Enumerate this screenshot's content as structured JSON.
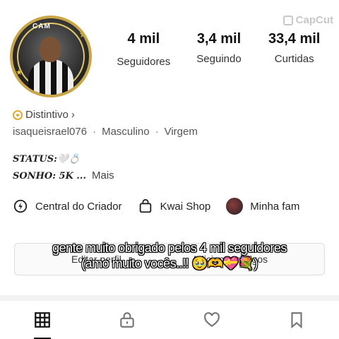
{
  "watermark": "CapCut",
  "avatar": {
    "tag": "CAM"
  },
  "stats": [
    {
      "value": "4 mil",
      "label": "Seguidores"
    },
    {
      "value": "3,4 mil",
      "label": "Seguindo"
    },
    {
      "value": "33,4 mil",
      "label": "Curtidas"
    }
  ],
  "badge": {
    "label": "Distintivo",
    "chevron": "›"
  },
  "meta": {
    "username": "isaqueisrael076",
    "gender": "Masculino",
    "sign": "Virgem",
    "separator": "·"
  },
  "bio": {
    "line1": "STATUS:🤍💍",
    "line2": "SONHO: 5K ...",
    "more": "Mais"
  },
  "shortcuts": [
    {
      "icon": "creator-center-icon",
      "label": "Central do Criador"
    },
    {
      "icon": "shopping-bag-icon",
      "label": "Kwai Shop"
    },
    {
      "icon": "family-avatar",
      "label": "Minha fam"
    }
  ],
  "edit": {
    "left": "Editar perfil",
    "right": "Adicionar amigos"
  },
  "overlay": {
    "line1": "gente muito obrigado pelos 4 mil seguidores",
    "line2": "(amo muito vocês..!! 🥹🫶💝💐)"
  },
  "tabs": [
    {
      "icon": "grid-icon",
      "active": true
    },
    {
      "icon": "lock-icon",
      "active": false
    },
    {
      "icon": "heart-icon",
      "active": false
    },
    {
      "icon": "bookmark-icon",
      "active": false
    }
  ]
}
